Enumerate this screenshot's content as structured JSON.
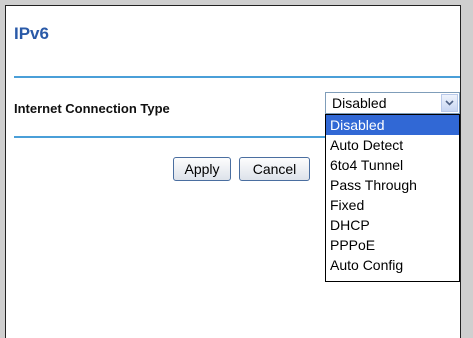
{
  "page": {
    "title": "IPv6"
  },
  "connection": {
    "label": "Internet Connection Type",
    "selected_value": "Disabled",
    "options": [
      "Disabled",
      "Auto Detect",
      "6to4 Tunnel",
      "Pass Through",
      "Fixed",
      "DHCP",
      "PPPoE",
      "Auto Config"
    ],
    "highlighted_option": "Disabled"
  },
  "buttons": {
    "apply_label": "Apply",
    "cancel_label": "Cancel"
  },
  "colors": {
    "title": "#2a5aa8",
    "rule": "#4a9fd8",
    "highlight": "#3168d5",
    "background": "#cfcfcf"
  },
  "icons": {
    "select_arrow": "chevron-down-icon"
  }
}
